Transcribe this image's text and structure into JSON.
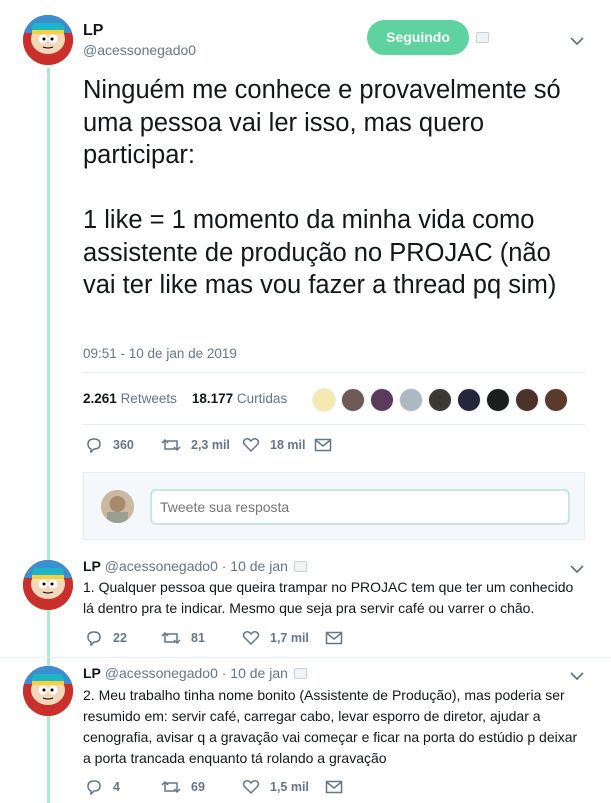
{
  "main_tweet": {
    "display_name": "LP",
    "handle": "@acessonegado0",
    "follow_label": "Seguindo",
    "text": "Ninguém me conhece e provavelmente só uma pessoa vai ler isso, mas quero participar:\n\n1 like = 1 momento da minha vida como assistente de produção no PROJAC (não vai ter like mas vou fazer a thread pq sim)",
    "timestamp": "09:51 - 10 de jan de 2019",
    "retweets_count": "2.261",
    "retweets_label": "Retweets",
    "likes_count": "18.177",
    "likes_label": "Curtidas",
    "replies": "360",
    "retweets": "2,3 mil",
    "likes": "18 mil"
  },
  "likers_colors": [
    "#f4e9b0",
    "#6b5a55",
    "#5c3a5e",
    "#aeb8c2",
    "#3b3a32",
    "#26263a",
    "#1d1d1d",
    "#4a3228",
    "#5a3a2c",
    "#3d2d2a"
  ],
  "reply_box": {
    "placeholder": "Tweete sua resposta"
  },
  "replies": [
    {
      "display_name": "LP",
      "handle": "@acessonegado0",
      "date": "· 10 de jan",
      "text": "1. Qualquer pessoa que queira trampar no PROJAC tem que ter um conhecido lá dentro pra te indicar. Mesmo que seja pra servir café ou varrer o chão.",
      "reply_count": "22",
      "retweet_count": "81",
      "like_count": "1,7 mil"
    },
    {
      "display_name": "LP",
      "handle": "@acessonegado0",
      "date": "· 10 de jan",
      "text": "2. Meu trabalho tinha nome bonito (Assistente de Produção), mas poderia ser resumido em: servir café, carregar cabo, levar esporro de diretor, ajudar a cenografia, avisar q a gravação vai começar e ficar na porta do estúdio p deixar a porta trancada enquanto tá rolando a gravação",
      "reply_count": "4",
      "retweet_count": "69",
      "like_count": "1,5 mil"
    }
  ],
  "colors": {
    "accent": "#5fd39f",
    "thread_line": "#a8eacb",
    "muted": "#657786"
  }
}
